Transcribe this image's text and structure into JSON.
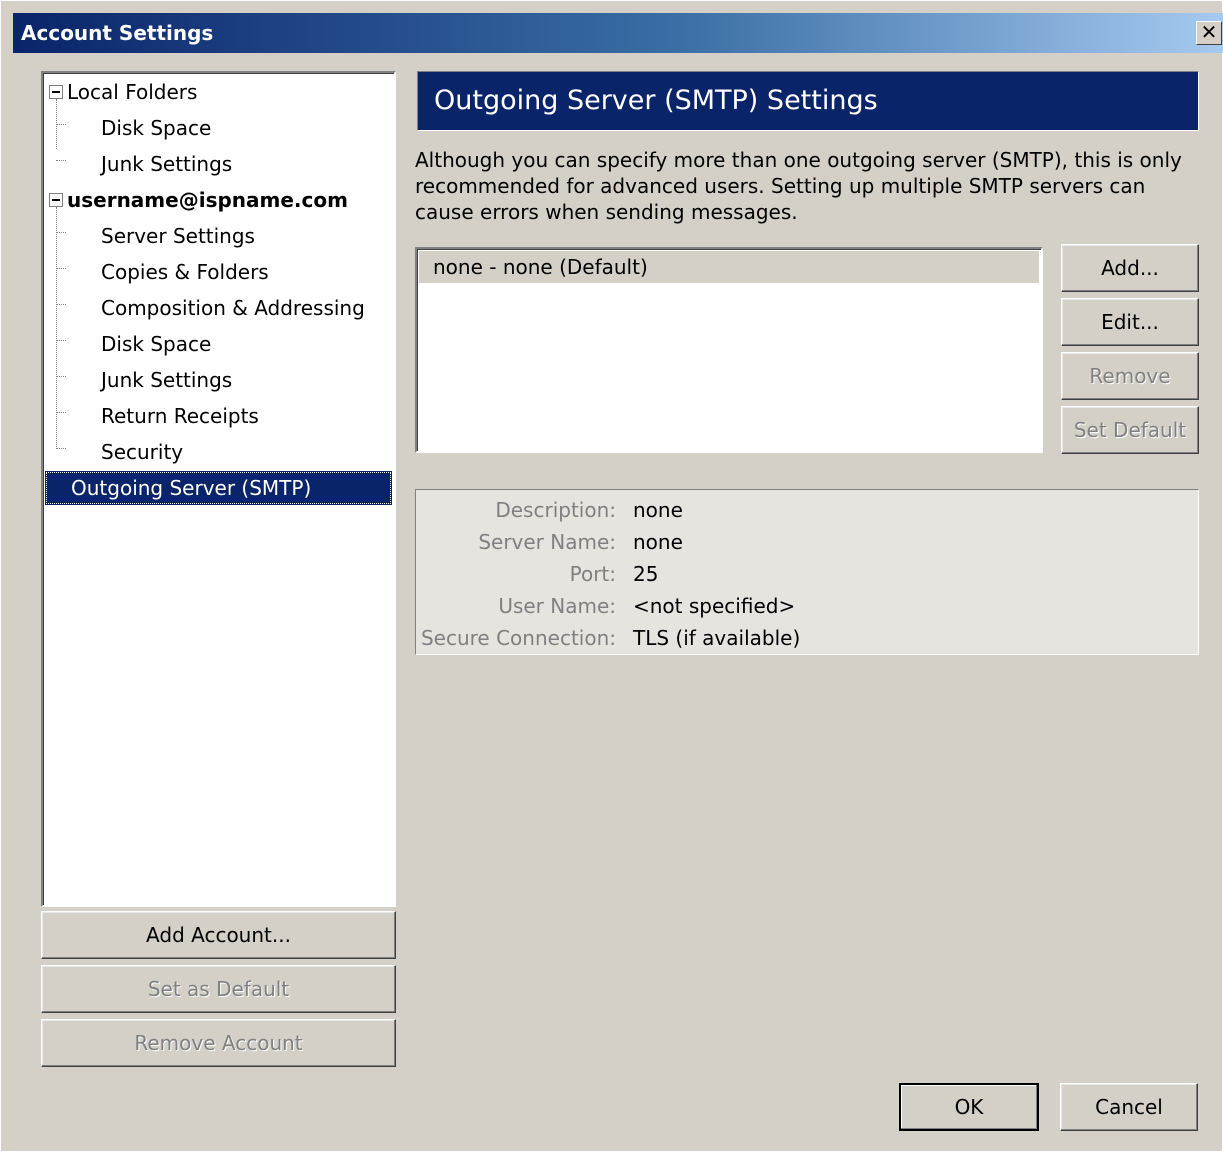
{
  "window": {
    "title": "Account Settings",
    "close_glyph": "✕"
  },
  "tree": {
    "local_folders": "Local Folders",
    "local_children": [
      "Disk Space",
      "Junk Settings"
    ],
    "account": "username@ispname.com",
    "account_children": [
      "Server Settings",
      "Copies & Folders",
      "Composition & Addressing",
      "Disk Space",
      "Junk Settings",
      "Return Receipts",
      "Security"
    ],
    "smtp": "Outgoing Server (SMTP)"
  },
  "left_buttons": {
    "add_account": "Add Account...",
    "set_default": "Set as Default",
    "remove_account": "Remove Account"
  },
  "panel": {
    "header": "Outgoing Server (SMTP) Settings",
    "description": "Although you can specify more than one outgoing server (SMTP), this is only recommended for advanced users. Setting up multiple SMTP servers can cause errors when sending messages.",
    "servers": [
      "none - none (Default)"
    ],
    "buttons": {
      "add": "Add...",
      "edit": "Edit...",
      "remove": "Remove",
      "set_default": "Set Default"
    },
    "details": [
      {
        "key": "Description:",
        "value": "none"
      },
      {
        "key": "Server Name:",
        "value": "none"
      },
      {
        "key": "Port:",
        "value": "25"
      },
      {
        "key": "User Name:",
        "value": "<not specified>"
      },
      {
        "key": "Secure Connection:",
        "value": "TLS (if available)"
      }
    ]
  },
  "footer": {
    "ok": "OK",
    "cancel": "Cancel"
  },
  "colors": {
    "selection": "#0a246a",
    "face": "#d4d0c8",
    "disabled_text": "#808080"
  }
}
